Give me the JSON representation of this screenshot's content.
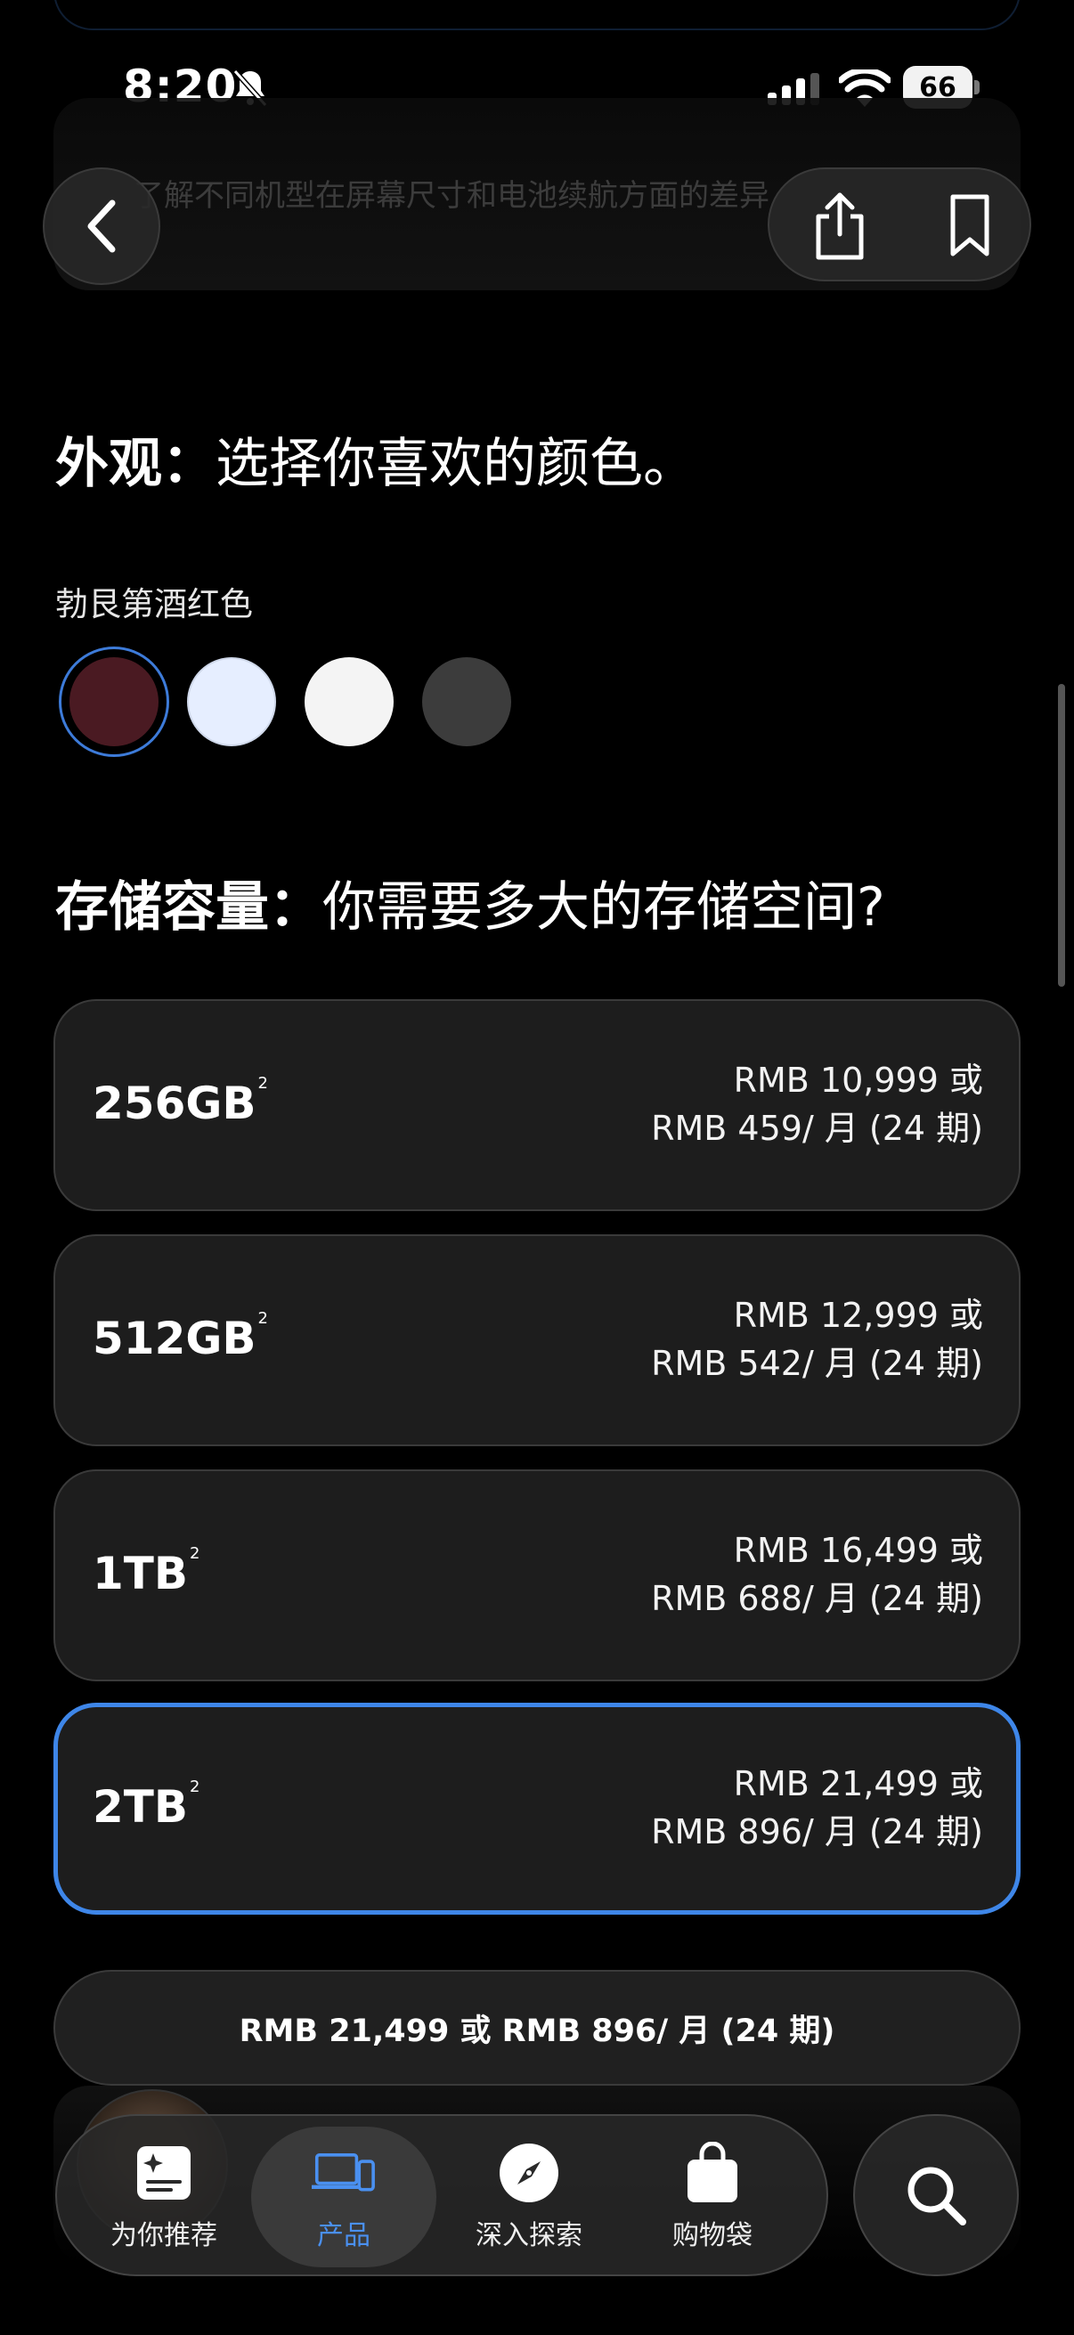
{
  "status_bar": {
    "time": "8:20",
    "battery": "66"
  },
  "nav": {
    "faded_text": "了解不同机型在屏幕尺寸和电池续航方面的差异"
  },
  "appearance": {
    "title_bold": "外观：",
    "title_rest": "选择你喜欢的颜色。",
    "selected_color_name": "勃艮第酒红色",
    "swatches": [
      "#4a1a22",
      "#e6eeff",
      "#f4f4f4",
      "#3c3c3c"
    ]
  },
  "storage": {
    "title_bold": "存储容量：",
    "title_rest": "你需要多大的存储空间?",
    "footnote": "2",
    "options": [
      {
        "capacity": "256GB",
        "price_line1": "RMB 10,999 或",
        "price_line2": "RMB 459/ 月 (24 期)"
      },
      {
        "capacity": "512GB",
        "price_line1": "RMB 12,999 或",
        "price_line2": "RMB 542/ 月 (24 期)"
      },
      {
        "capacity": "1TB",
        "price_line1": "RMB 16,499 或",
        "price_line2": "RMB 688/ 月 (24 期)"
      },
      {
        "capacity": "2TB",
        "price_line1": "RMB 21,499 或",
        "price_line2": "RMB 896/ 月 (24 期)"
      }
    ]
  },
  "price_bar": {
    "summary": "RMB 21,499 或 RMB 896/ 月 (24 期)"
  },
  "tabs": [
    {
      "label": "为你推荐"
    },
    {
      "label": "产品"
    },
    {
      "label": "深入探索"
    },
    {
      "label": "购物袋"
    }
  ],
  "colors": {
    "accent": "#3e86e8",
    "card_bg": "#1d1d1d"
  }
}
